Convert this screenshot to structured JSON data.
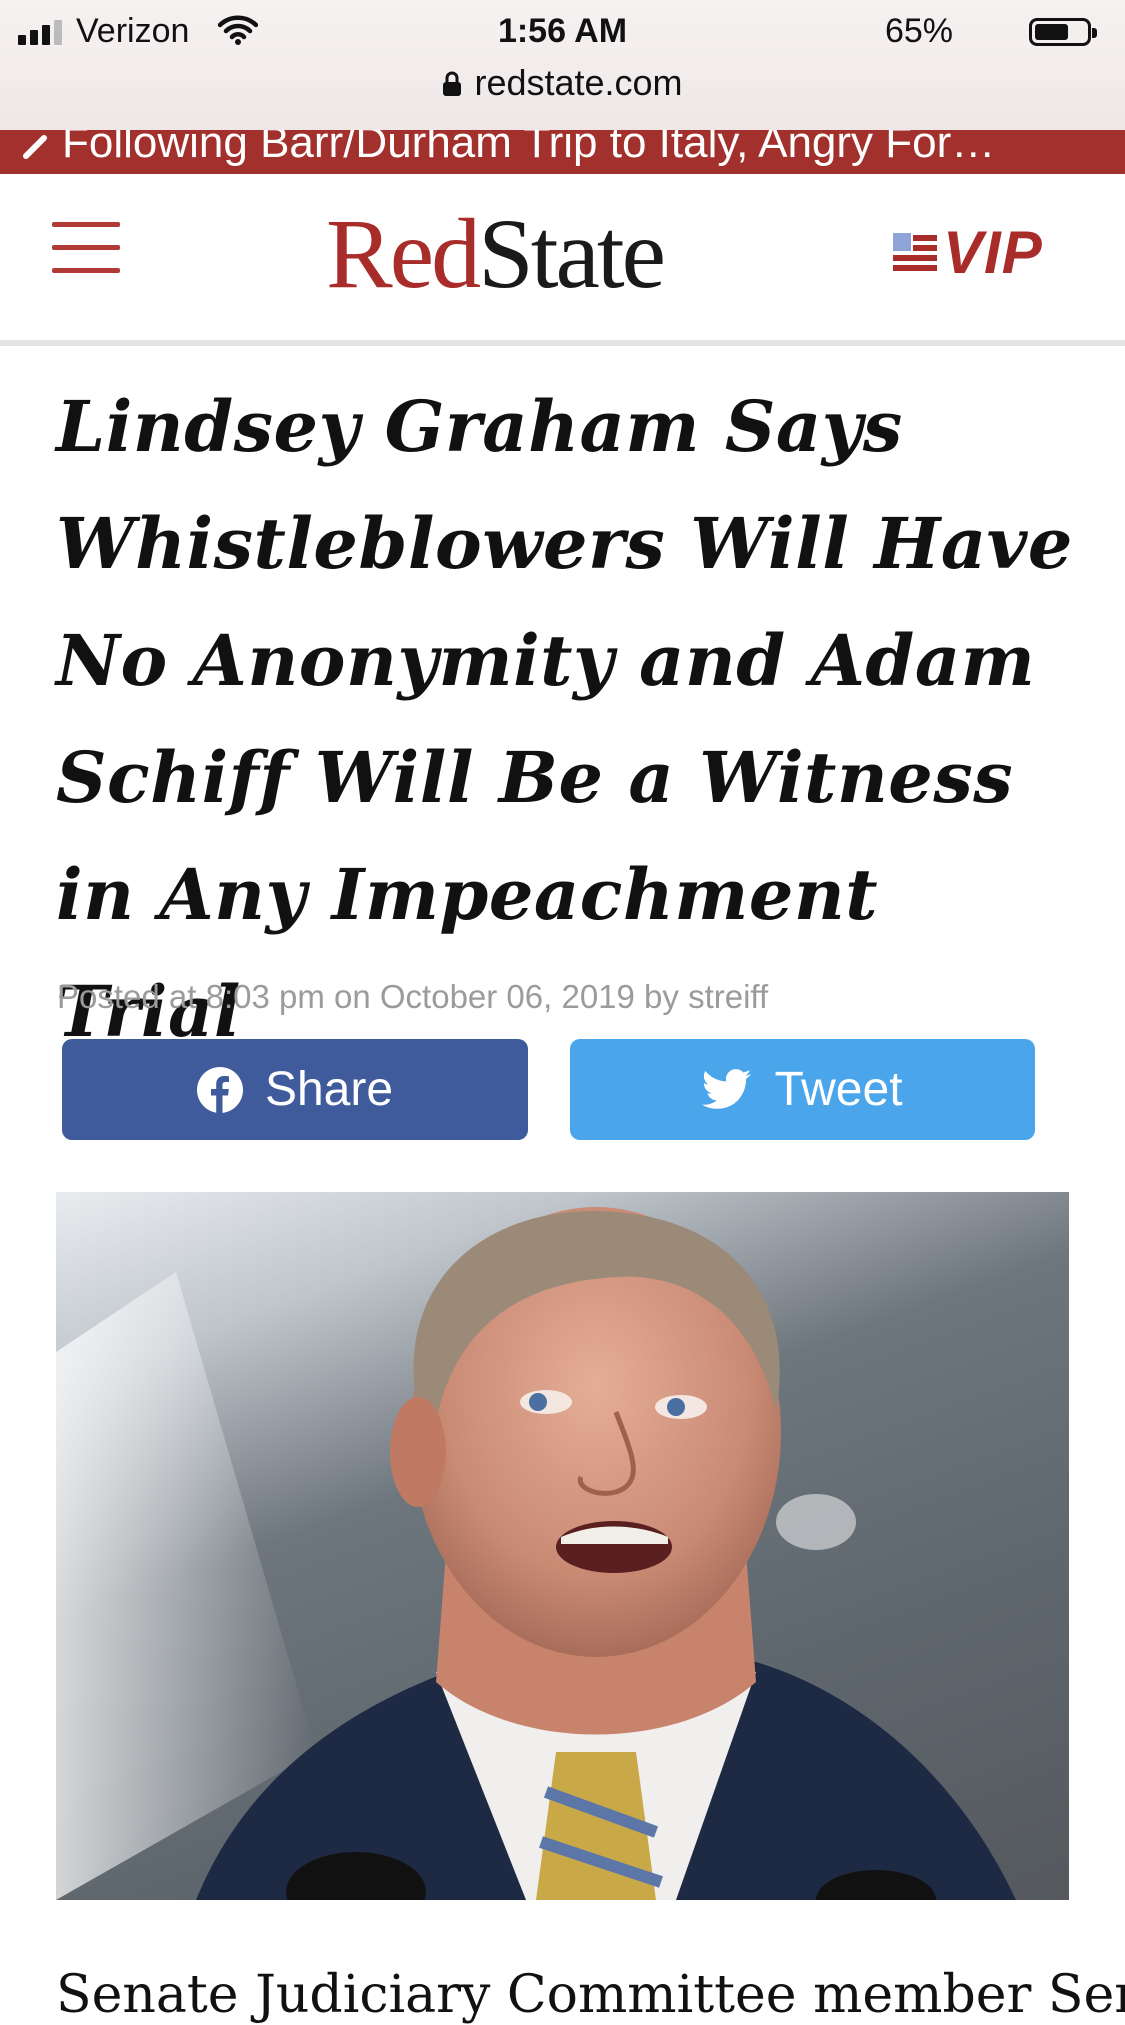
{
  "status_bar": {
    "carrier": "Verizon",
    "time": "1:56 AM",
    "battery_percent": "65%",
    "battery_level": 0.65
  },
  "browser": {
    "url": "redstate.com"
  },
  "trending": {
    "text": "Following Barr/Durham Trip to Italy, Angry For…"
  },
  "header": {
    "logo_red": "Red",
    "logo_dark": "State",
    "vip_label": "VIP"
  },
  "article": {
    "headline": "Lindsey Graham Says Whistleblowers Will Have No Anonymity and Adam Schiff Will Be a Witness in Any Impeachment Trial",
    "byline": "Posted at 8:03 pm on October 06, 2019 by streiff",
    "share_label": "Share",
    "tweet_label": "Tweet",
    "body_start": "Senate Judiciary Committee member Sen."
  },
  "colors": {
    "brand_red": "#a82d2a",
    "facebook": "#3f5b9c",
    "twitter": "#4aa5ea"
  },
  "icons": [
    "lock-icon",
    "wifi-icon",
    "chevron-icon",
    "hamburger-icon",
    "flag-icon",
    "facebook-icon",
    "twitter-icon"
  ]
}
